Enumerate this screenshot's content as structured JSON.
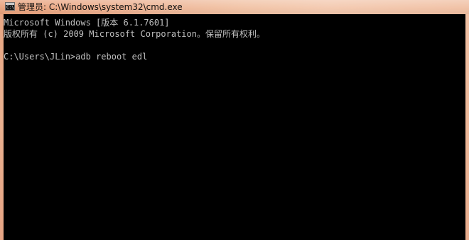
{
  "window": {
    "title": "管理员: C:\\Windows\\system32\\cmd.exe",
    "icon": "cmd-icon",
    "icon_glyph": "C:\\"
  },
  "console": {
    "foreground": "#c0c0c0",
    "background": "#000000",
    "lines": [
      "Microsoft Windows [版本 6.1.7601]",
      "版权所有 (c) 2009 Microsoft Corporation。保留所有权利。",
      "",
      "C:\\Users\\JLin>adb reboot edl"
    ]
  }
}
